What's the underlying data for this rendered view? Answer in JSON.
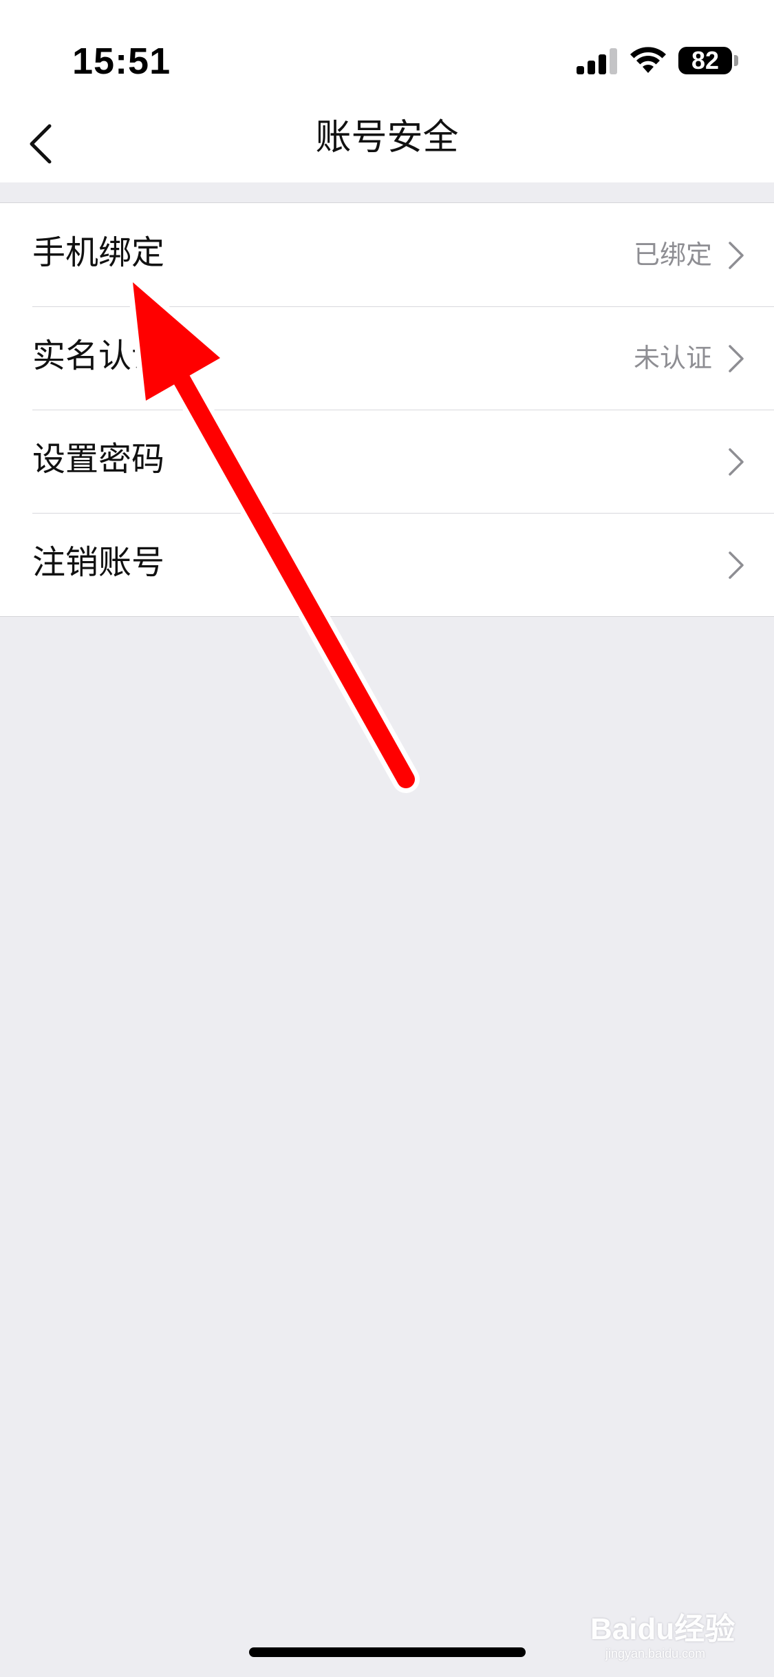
{
  "status_bar": {
    "time": "15:51",
    "battery_level": "82",
    "signal_bars": 3,
    "signal_bars_total": 4,
    "icons": [
      "signal-icon",
      "wifi-icon",
      "battery-icon"
    ]
  },
  "nav": {
    "title": "账号安全",
    "back_icon": "chevron-left-icon"
  },
  "settings": [
    {
      "label": "手机绑定",
      "value": "已绑定"
    },
    {
      "label": "实名认证",
      "value": "未认证"
    },
    {
      "label": "设置密码",
      "value": ""
    },
    {
      "label": "注销账号",
      "value": ""
    }
  ],
  "annotation": {
    "icon": "red-arrow",
    "color": "#ff0000"
  },
  "watermark": {
    "text": "Baidu经验",
    "sub": "jingyan.baidu.com"
  },
  "colors": {
    "background": "#ededf1",
    "surface": "#ffffff",
    "secondary_text": "#8e8e93",
    "arrow": "#ff0000"
  }
}
